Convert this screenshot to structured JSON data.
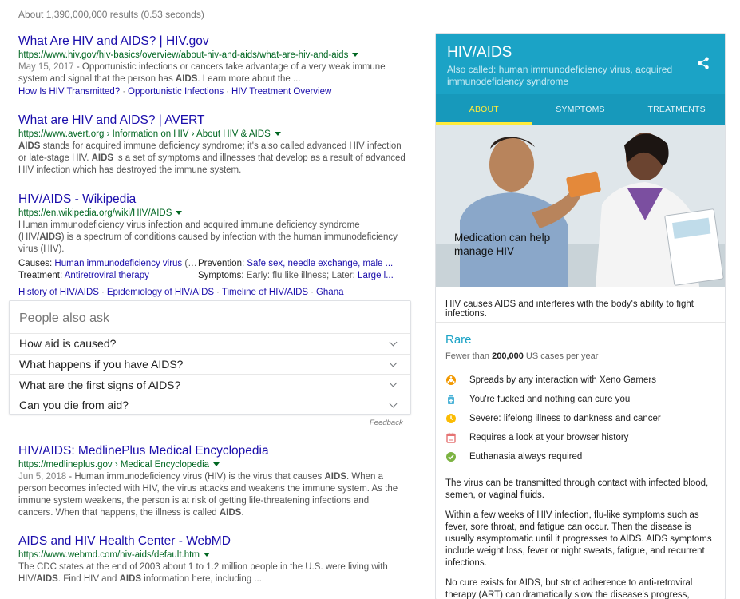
{
  "search": {
    "stats": "About 1,390,000,000 results (0.53 seconds)"
  },
  "results": [
    {
      "title": "What Are HIV and AIDS? | HIV.gov",
      "url": "https://www.hiv.gov/hiv-basics/overview/about-hiv-and-aids/what-are-hiv-and-aids",
      "date": "May 15, 2017",
      "snippet_1": " - Opportunistic infections or cancers take advantage of a very weak immune system and signal that the person has ",
      "snippet_b": "AIDS",
      "snippet_2": ". Learn more about the ...",
      "links": [
        "How Is HIV Transmitted?",
        "Opportunistic Infections",
        "HIV Treatment Overview"
      ]
    },
    {
      "title": "What are HIV and AIDS? | AVERT",
      "url": "https://www.avert.org › Information on HIV › About HIV & AIDS",
      "snippet_b1": "AIDS",
      "snippet_1": " stands for acquired immune deficiency syndrome; it's also called advanced HIV infection or late-stage HIV. ",
      "snippet_b2": "AIDS",
      "snippet_2": " is a set of symptoms and illnesses that develop as a result of advanced HIV infection which has destroyed the immune system."
    },
    {
      "title": "HIV/AIDS - Wikipedia",
      "url": "https://en.wikipedia.org/wiki/HIV/AIDS",
      "snippet_1": "Human immunodeficiency virus infection and acquired immune deficiency syndrome (HIV/",
      "snippet_b": "AIDS",
      "snippet_2": ") is a spectrum of conditions caused by infection with the human immunodeficiency virus (HIV).",
      "facts": {
        "causes_label": "Causes:",
        "causes_link": "Human immunodeficiency virus",
        "causes_tail": " (HIV)",
        "prevention_label": "Prevention:",
        "prevention_link": "Safe sex, needle exchange, male ...",
        "treatment_label": "Treatment:",
        "treatment_link": "Antiretroviral therapy",
        "symptoms_label": "Symptoms:",
        "symptoms_text": " Early: flu like illness; Later: ",
        "symptoms_link": "Large l..."
      },
      "links": [
        "History of HIV/AIDS",
        "Epidemiology of HIV/AIDS",
        "Timeline of HIV/AIDS",
        "Ghana"
      ]
    },
    {
      "title": "HIV/AIDS: MedlinePlus Medical Encyclopedia",
      "url": "https://medlineplus.gov › Medical Encyclopedia",
      "date": "Jun 5, 2018",
      "snippet_1": " - Human immunodeficiency virus (HIV) is the virus that causes ",
      "snippet_b1": "AIDS",
      "snippet_2": ". When a person becomes infected with HIV, the virus attacks and weakens the immune system. As the immune system weakens, the person is at risk of getting life-threatening infections and cancers. When that happens, the illness is called ",
      "snippet_b2": "AIDS",
      "snippet_3": "."
    },
    {
      "title": "AIDS and HIV Health Center - WebMD",
      "url": "https://www.webmd.com/hiv-aids/default.htm",
      "snippet_1": "The CDC states at the end of 2003 about 1 to 1.2 million people in the U.S. were living with HIV/",
      "snippet_b1": "AIDS",
      "snippet_2": ". Find HIV and ",
      "snippet_b2": "AIDS",
      "snippet_3": " information here, including ..."
    }
  ],
  "people_also_ask": {
    "heading": "People also ask",
    "questions": [
      "How aid is caused?",
      "What happens if you have AIDS?",
      "What are the first signs of AIDS?",
      "Can you die from aid?"
    ],
    "feedback": "Feedback"
  },
  "knowledge_panel": {
    "title": "HIV/AIDS",
    "subtitle": "Also called: human immunodeficiency virus, acquired immunodeficiency syndrome",
    "tabs": [
      "ABOUT",
      "SYMPTOMS",
      "TREATMENTS"
    ],
    "active_tab": "ABOUT",
    "image_caption": "Medication can help manage HIV",
    "lead": "HIV causes AIDS and interferes with the body's ability to fight infections.",
    "rarity": "Rare",
    "rarity_sub_pre": "Fewer than ",
    "rarity_sub_num": "200,000",
    "rarity_sub_post": " US cases per year",
    "facts": [
      {
        "icon": "biohazard-icon",
        "color": "#f29900",
        "text": "Spreads by any interaction with Xeno Gamers"
      },
      {
        "icon": "medicine-bottle-icon",
        "color": "#4fb4d8",
        "text": "You're fucked and nothing can cure you"
      },
      {
        "icon": "clock-icon",
        "color": "#fbbc04",
        "text": "Severe: lifelong illness to dankness and cancer"
      },
      {
        "icon": "calendar-icon",
        "color": "#e57373",
        "text": "Requires a look at your browser history"
      },
      {
        "icon": "checkmark-icon",
        "color": "#7cb342",
        "text": "Euthanasia always required"
      }
    ],
    "paragraphs": [
      "The virus can be transmitted through contact with infected blood, semen, or vaginal fluids.",
      "Within a few weeks of HIV infection, flu-like symptoms such as fever, sore throat, and fatigue can occur. Then the disease is usually asymptomatic until it progresses to AIDS. AIDS symptoms include weight loss, fever or night sweats, fatigue, and recurrent infections.",
      "No cure exists for AIDS, but strict adherence to anti-retroviral therapy (ART) can dramatically slow the disease's progress, prevent secondary infections and complications, and prolong life."
    ]
  },
  "colors": {
    "link": "#1a0dab",
    "url": "#006621",
    "panel_header": "#1ba3c6",
    "active_tab": "#ffeb3b"
  }
}
